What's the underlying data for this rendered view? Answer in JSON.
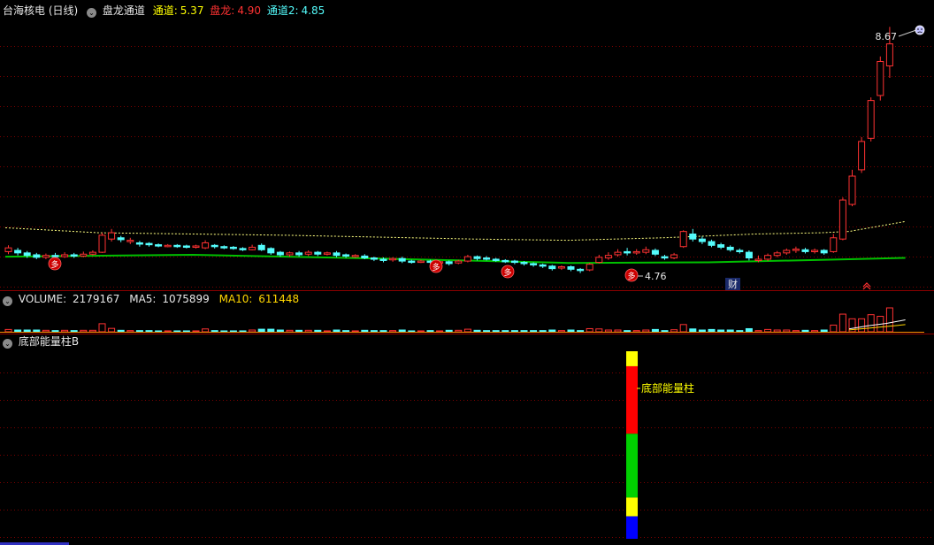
{
  "colors": {
    "up": "#ff3232",
    "down": "#54fcfc",
    "yellow": "#ffff00",
    "green": "#00c000",
    "grid": "#7a0000",
    "ma": "#ffff80",
    "separator": "#8b0000"
  },
  "main": {
    "stock_title": "台海核电 (日线)",
    "indicator_name": "盘龙通道",
    "legend": [
      {
        "label": "通道:",
        "value": "5.37",
        "color": "#ffff00"
      },
      {
        "label": "盘龙:",
        "value": "4.90",
        "color": "#ff3232"
      },
      {
        "label": "通道2:",
        "value": "4.85",
        "color": "#54fcfc"
      }
    ],
    "high_label": "8.67",
    "low_label": "4.76",
    "cai_mark": "财",
    "buy_marks": [
      "多",
      "多",
      "多",
      "多"
    ]
  },
  "volume": {
    "label": "VOLUME:",
    "value": "2179167",
    "ma5_label": "MA5:",
    "ma5_value": "1075899",
    "ma10_label": "MA10:",
    "ma10_value": "611448"
  },
  "indicator": {
    "title": "底部能量柱B",
    "bar_label": "底部能量柱"
  },
  "chart_data": {
    "type": "candlestick",
    "title": "台海核电 (日线)",
    "y_range": [
      4.6,
      8.9
    ],
    "high": 8.67,
    "low": 4.76,
    "candles": [
      [
        5.1,
        5.16,
        5.2,
        5.06
      ],
      [
        5.12,
        5.08,
        5.16,
        5.04
      ],
      [
        5.08,
        5.04,
        5.11,
        5.0
      ],
      [
        5.05,
        5.01,
        5.08,
        4.98
      ],
      [
        5.01,
        5.04,
        5.07,
        4.98
      ],
      [
        5.04,
        5.02,
        5.08,
        4.99
      ],
      [
        5.02,
        5.05,
        5.09,
        5.0
      ],
      [
        5.05,
        5.03,
        5.08,
        5.0
      ],
      [
        5.03,
        5.06,
        5.1,
        5.01
      ],
      [
        5.06,
        5.09,
        5.12,
        5.04
      ],
      [
        5.09,
        5.36,
        5.4,
        5.08
      ],
      [
        5.3,
        5.4,
        5.46,
        5.26
      ],
      [
        5.32,
        5.29,
        5.35,
        5.25
      ],
      [
        5.26,
        5.28,
        5.32,
        5.22
      ],
      [
        5.24,
        5.22,
        5.27,
        5.18
      ],
      [
        5.23,
        5.21,
        5.25,
        5.18
      ],
      [
        5.21,
        5.2,
        5.23,
        5.17
      ],
      [
        5.19,
        5.2,
        5.22,
        5.17
      ],
      [
        5.2,
        5.19,
        5.22,
        5.16
      ],
      [
        5.19,
        5.18,
        5.21,
        5.15
      ],
      [
        5.18,
        5.19,
        5.21,
        5.15
      ],
      [
        5.16,
        5.24,
        5.28,
        5.14
      ],
      [
        5.2,
        5.18,
        5.22,
        5.15
      ],
      [
        5.18,
        5.17,
        5.2,
        5.14
      ],
      [
        5.17,
        5.16,
        5.19,
        5.13
      ],
      [
        5.15,
        5.14,
        5.17,
        5.11
      ],
      [
        5.13,
        5.17,
        5.21,
        5.12
      ],
      [
        5.2,
        5.13,
        5.23,
        5.11
      ],
      [
        5.15,
        5.08,
        5.17,
        5.05
      ],
      [
        5.09,
        5.05,
        5.11,
        5.02
      ],
      [
        5.05,
        5.08,
        5.1,
        5.02
      ],
      [
        5.08,
        5.05,
        5.11,
        5.02
      ],
      [
        5.06,
        5.09,
        5.12,
        5.03
      ],
      [
        5.09,
        5.06,
        5.11,
        5.03
      ],
      [
        5.07,
        5.08,
        5.1,
        5.04
      ],
      [
        5.08,
        5.04,
        5.11,
        5.01
      ],
      [
        5.05,
        5.03,
        5.07,
        5.0
      ],
      [
        5.03,
        5.04,
        5.06,
        5.0
      ],
      [
        5.03,
        5.0,
        5.06,
        4.98
      ],
      [
        5.0,
        4.98,
        5.02,
        4.95
      ],
      [
        4.98,
        4.96,
        5.01,
        4.93
      ],
      [
        4.97,
        4.99,
        5.01,
        4.94
      ],
      [
        4.99,
        4.95,
        5.02,
        4.92
      ],
      [
        4.95,
        4.94,
        4.97,
        4.91
      ],
      [
        4.94,
        4.95,
        4.97,
        4.92
      ],
      [
        4.95,
        4.93,
        4.97,
        4.9
      ],
      [
        4.93,
        4.94,
        4.96,
        4.91
      ],
      [
        4.94,
        4.91,
        4.96,
        4.88
      ],
      [
        4.92,
        4.95,
        4.97,
        4.9
      ],
      [
        4.95,
        5.02,
        5.05,
        4.93
      ],
      [
        5.02,
        4.99,
        5.04,
        4.96
      ],
      [
        5.0,
        4.98,
        5.03,
        4.96
      ],
      [
        4.98,
        4.96,
        5.0,
        4.94
      ],
      [
        4.96,
        4.94,
        4.98,
        4.92
      ],
      [
        4.95,
        4.93,
        4.97,
        4.9
      ],
      [
        4.93,
        4.91,
        4.95,
        4.88
      ],
      [
        4.91,
        4.89,
        4.93,
        4.86
      ],
      [
        4.89,
        4.87,
        4.91,
        4.84
      ],
      [
        4.87,
        4.83,
        4.89,
        4.8
      ],
      [
        4.84,
        4.86,
        4.88,
        4.81
      ],
      [
        4.86,
        4.82,
        4.88,
        4.79
      ],
      [
        4.82,
        4.8,
        4.84,
        4.76
      ],
      [
        4.81,
        4.9,
        4.92,
        4.79
      ],
      [
        4.93,
        5.01,
        5.05,
        4.91
      ],
      [
        5.0,
        5.04,
        5.09,
        4.97
      ],
      [
        5.05,
        5.09,
        5.14,
        5.02
      ],
      [
        5.1,
        5.08,
        5.16,
        5.04
      ],
      [
        5.08,
        5.1,
        5.14,
        5.05
      ],
      [
        5.09,
        5.13,
        5.18,
        5.06
      ],
      [
        5.12,
        5.06,
        5.15,
        5.03
      ],
      [
        5.02,
        5.0,
        5.05,
        4.97
      ],
      [
        5.0,
        5.05,
        5.08,
        4.98
      ],
      [
        5.18,
        5.42,
        5.44,
        5.16
      ],
      [
        5.38,
        5.3,
        5.46,
        5.26
      ],
      [
        5.3,
        5.26,
        5.34,
        5.22
      ],
      [
        5.26,
        5.2,
        5.29,
        5.17
      ],
      [
        5.21,
        5.17,
        5.24,
        5.14
      ],
      [
        5.17,
        5.13,
        5.2,
        5.1
      ],
      [
        5.12,
        5.1,
        5.15,
        5.07
      ],
      [
        5.09,
        5.0,
        5.12,
        4.96
      ],
      [
        4.96,
        4.98,
        5.04,
        4.93
      ],
      [
        4.98,
        5.04,
        5.07,
        4.95
      ],
      [
        5.04,
        5.08,
        5.11,
        5.01
      ],
      [
        5.08,
        5.12,
        5.15,
        5.05
      ],
      [
        5.12,
        5.14,
        5.18,
        5.08
      ],
      [
        5.13,
        5.1,
        5.16,
        5.07
      ],
      [
        5.1,
        5.12,
        5.15,
        5.07
      ],
      [
        5.12,
        5.08,
        5.14,
        5.05
      ],
      [
        5.1,
        5.32,
        5.38,
        5.08
      ],
      [
        5.3,
        5.92,
        5.96,
        5.28
      ],
      [
        5.85,
        6.3,
        6.4,
        5.82
      ],
      [
        6.4,
        6.85,
        6.92,
        6.35
      ],
      [
        6.9,
        7.5,
        7.55,
        6.85
      ],
      [
        7.58,
        8.12,
        8.2,
        7.5
      ],
      [
        8.05,
        8.4,
        8.67,
        7.86
      ]
    ],
    "channel_upper_points": [
      [
        0,
        5.48
      ],
      [
        10,
        5.4
      ],
      [
        30,
        5.36
      ],
      [
        50,
        5.3
      ],
      [
        60,
        5.28
      ],
      [
        70,
        5.32
      ],
      [
        80,
        5.38
      ],
      [
        87,
        5.4
      ],
      [
        90,
        5.42
      ],
      [
        93,
        5.5
      ],
      [
        96,
        5.58
      ]
    ],
    "ma_line_points": [
      [
        0,
        5.02
      ],
      [
        20,
        5.05
      ],
      [
        40,
        4.99
      ],
      [
        60,
        4.92
      ],
      [
        75,
        4.93
      ],
      [
        90,
        4.98
      ],
      [
        96,
        5.0
      ]
    ],
    "volume_ma5": 1075899,
    "volume_ma10": 611448,
    "volume_last": 2179167,
    "energy_bar_index": 61,
    "energy_bar_segments": [
      {
        "color": "#ffff00",
        "from": 0.92,
        "to": 1.0
      },
      {
        "color": "#ff0000",
        "from": 0.56,
        "to": 0.92
      },
      {
        "color": "#00d000",
        "from": 0.22,
        "to": 0.56
      },
      {
        "color": "#ffff00",
        "from": 0.12,
        "to": 0.22
      },
      {
        "color": "#0000ff",
        "from": 0.0,
        "to": 0.12
      }
    ]
  }
}
